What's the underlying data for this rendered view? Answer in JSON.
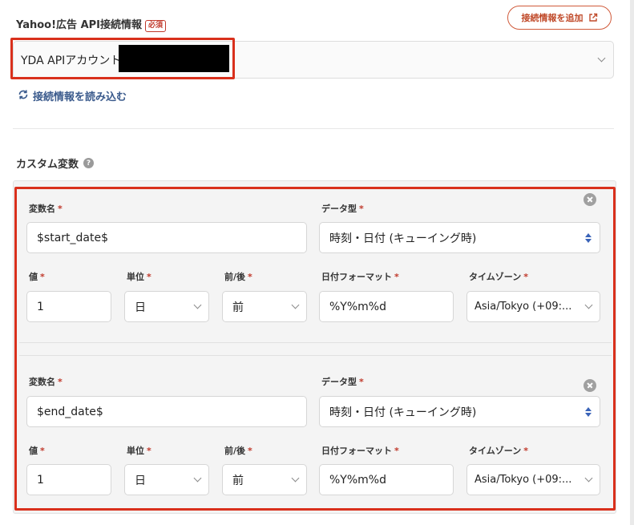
{
  "connection": {
    "label": "Yahoo!広告 API接続情報",
    "required_badge": "必須",
    "add_button_label": "接続情報を追加",
    "account_value": "YDA APIアカウント",
    "reload_label": "接続情報を読み込む"
  },
  "custom_vars": {
    "title": "カスタム変数",
    "help_glyph": "?",
    "labels": {
      "name": "変数名",
      "type": "データ型",
      "value": "値",
      "unit": "単位",
      "direction": "前/後",
      "date_format": "日付フォーマット",
      "timezone": "タイムゾーン",
      "asterisk": "*"
    },
    "rows": [
      {
        "name": "$start_date$",
        "type": "時刻・日付 (キューイング時)",
        "value": "1",
        "unit": "日",
        "direction": "前",
        "date_format": "%Y%m%d",
        "timezone": "Asia/Tokyo (+09:..."
      },
      {
        "name": "$end_date$",
        "type": "時刻・日付 (キューイング時)",
        "value": "1",
        "unit": "日",
        "direction": "前",
        "date_format": "%Y%m%d",
        "timezone": "Asia/Tokyo (+09:..."
      }
    ]
  },
  "colors": {
    "highlight": "#d9301c",
    "accent_link": "#3a5a8c",
    "required": "#c0392b"
  }
}
